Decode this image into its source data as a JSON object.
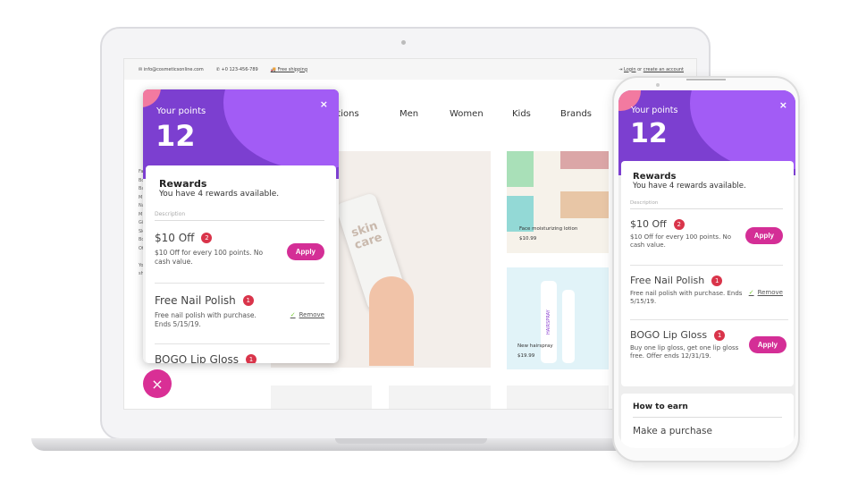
{
  "topbar": {
    "email": "info@cosmeticsonline.com",
    "phone": "+0 123-456-789",
    "shipping": "Free shipping",
    "login": "Login",
    "or": " or ",
    "create": "create an account"
  },
  "nav": [
    "Collections",
    "Men",
    "Women",
    "Kids",
    "Brands"
  ],
  "products": [
    {
      "name": "Face moisturizing lotion",
      "price": "$10.99"
    },
    {
      "name": "New hairspray",
      "price": "$19.99"
    }
  ],
  "product_art": {
    "skin_care": "skin care",
    "hairspray": "HAIRSPRAY"
  },
  "widget": {
    "points_label": "Your points",
    "points": "12",
    "close": "×",
    "rewards_title": "Rewards",
    "rewards_sub": "You have 4 rewards available.",
    "desc_label": "Description",
    "items": [
      {
        "title": "$10 Off",
        "count": "2",
        "desc": "$10 Off for every 100 points. No cash value.",
        "action": "Apply"
      },
      {
        "title": "Free Nail Polish",
        "count": "1",
        "desc": "Free nail polish with purchase. Ends 5/15/19.",
        "action": "Remove"
      },
      {
        "title": "BOGO Lip Gloss",
        "count": "1",
        "desc": "Buy one lip gloss, get one lip gloss free. Offer ends 12/31/19.",
        "action": "Apply"
      }
    ],
    "how_to_earn": "How to earn",
    "earn_item": "Make a purchase"
  },
  "fab_icon": "close-icon",
  "colors": {
    "purple": "#7c3fd0",
    "pink": "#d42e96",
    "badge": "#d9344a"
  }
}
